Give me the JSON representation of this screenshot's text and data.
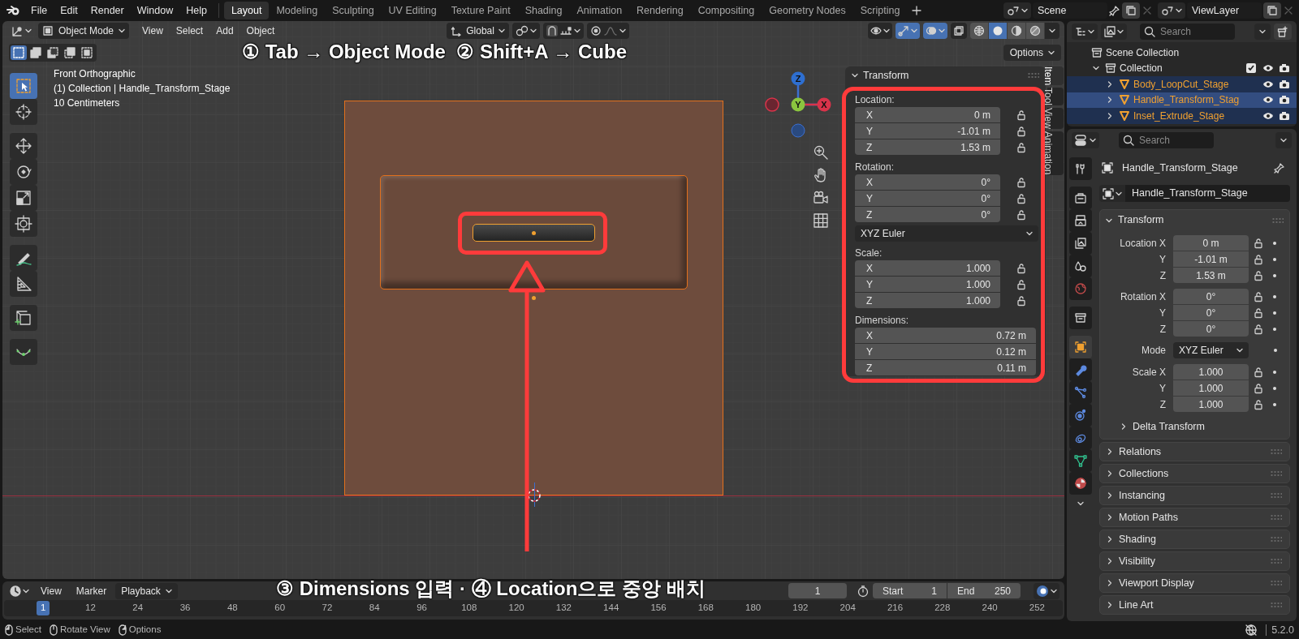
{
  "menu": [
    "File",
    "Edit",
    "Render",
    "Window",
    "Help"
  ],
  "workspaces": [
    {
      "label": "Layout",
      "selected": true
    },
    {
      "label": "Modeling",
      "selected": false
    },
    {
      "label": "Sculpting",
      "selected": false
    },
    {
      "label": "UV Editing",
      "selected": false
    },
    {
      "label": "Texture Paint",
      "selected": false
    },
    {
      "label": "Shading",
      "selected": false
    },
    {
      "label": "Animation",
      "selected": false
    },
    {
      "label": "Rendering",
      "selected": false
    },
    {
      "label": "Compositing",
      "selected": false
    },
    {
      "label": "Geometry Nodes",
      "selected": false
    },
    {
      "label": "Scripting",
      "selected": false
    }
  ],
  "scene": "Scene",
  "view_layer": "ViewLayer",
  "viewport": {
    "mode": "Object Mode",
    "menus": [
      "View",
      "Select",
      "Add",
      "Object"
    ],
    "orientation": "Global",
    "options": "Options",
    "toggles": [
      {
        "kind": "visibility",
        "on": false
      },
      {
        "kind": "gizmo",
        "on": true
      },
      {
        "kind": "overlay",
        "on": true
      },
      {
        "kind": "xray",
        "on": false
      }
    ],
    "shading_modes": [
      {
        "kind": "wireframe",
        "selected": false
      },
      {
        "kind": "solid",
        "selected": true
      },
      {
        "kind": "material",
        "selected": false
      },
      {
        "kind": "rendered",
        "selected": false
      }
    ],
    "select_modes": [
      {
        "kind": "set",
        "selected": true
      },
      {
        "kind": "extend",
        "selected": false
      },
      {
        "kind": "subtract",
        "selected": false
      },
      {
        "kind": "invert",
        "selected": false
      },
      {
        "kind": "intersect",
        "selected": false
      }
    ],
    "info": [
      "Front Orthographic",
      "(1) Collection | Handle_Transform_Stage",
      "10 Centimeters"
    ],
    "tools": [
      {
        "kind": "select_box",
        "selected": true
      },
      {
        "kind": "cursor",
        "selected": false
      },
      {
        "kind": "move",
        "selected": false
      },
      {
        "kind": "rotate",
        "selected": false
      },
      {
        "kind": "scale",
        "selected": false
      },
      {
        "kind": "transform",
        "selected": false
      },
      {
        "kind": "annotate",
        "selected": false
      },
      {
        "kind": "measure",
        "selected": false
      },
      {
        "kind": "add_cube",
        "selected": false
      },
      {
        "kind": "curve",
        "selected": false
      }
    ],
    "axes": {
      "up": "Z",
      "center": "Y",
      "right": "X"
    },
    "side_tabs": [
      {
        "label": "Item",
        "selected": true
      },
      {
        "label": "Tool",
        "selected": false
      },
      {
        "label": "View",
        "selected": false
      },
      {
        "label": "Animation",
        "selected": false
      }
    ],
    "captions": [
      "① Tab → Object Mode  ② Shift+A → Cube",
      "③ Dimensions 입력 · ④ Location으로 중앙 배치"
    ]
  },
  "n_panel": {
    "title": "Transform",
    "expanded": true,
    "sections": [
      {
        "kind": "fields",
        "label": "Location:",
        "rows": [
          {
            "axis": "X",
            "value": "0 m",
            "locked": false
          },
          {
            "axis": "Y",
            "value": "-1.01 m",
            "locked": false
          },
          {
            "axis": "Z",
            "value": "1.53 m",
            "locked": false
          }
        ]
      },
      {
        "kind": "fields",
        "label": "Rotation:",
        "rows": [
          {
            "axis": "X",
            "value": "0°",
            "locked": false
          },
          {
            "axis": "Y",
            "value": "0°",
            "locked": false
          },
          {
            "axis": "Z",
            "value": "0°",
            "locked": false
          }
        ]
      },
      {
        "kind": "dropdown",
        "value": "XYZ Euler"
      },
      {
        "kind": "fields",
        "label": "Scale:",
        "rows": [
          {
            "axis": "X",
            "value": "1.000",
            "locked": false
          },
          {
            "axis": "Y",
            "value": "1.000",
            "locked": false
          },
          {
            "axis": "Z",
            "value": "1.000",
            "locked": false
          }
        ]
      },
      {
        "kind": "fields",
        "label": "Dimensions:",
        "rows": [
          {
            "axis": "X",
            "value": "0.72 m"
          },
          {
            "axis": "Y",
            "value": "0.12 m"
          },
          {
            "axis": "Z",
            "value": "0.11 m"
          }
        ]
      }
    ]
  },
  "outliner": {
    "search_placeholder": "Search",
    "tree": [
      {
        "label": "Scene Collection",
        "children": [
          {
            "label": "Collection",
            "expanded": true,
            "checked": true,
            "children": [
              {
                "label": "Body_LoopCut_Stage",
                "expanded": false,
                "selected": true,
                "active": false
              },
              {
                "label": "Handle_Transform_Stag",
                "expanded": false,
                "selected": true,
                "active": true
              },
              {
                "label": "Inset_Extrude_Stage",
                "expanded": false,
                "selected": true,
                "active": false
              }
            ]
          }
        ]
      }
    ]
  },
  "properties": {
    "search_placeholder": "Search",
    "tabs": [
      {
        "kind": "tool",
        "selected": false
      },
      {
        "kind": "render",
        "selected": false
      },
      {
        "kind": "output",
        "selected": false
      },
      {
        "kind": "view_layer",
        "selected": false
      },
      {
        "kind": "scene",
        "selected": false
      },
      {
        "kind": "world",
        "selected": false
      },
      {
        "kind": "collection",
        "selected": false
      },
      {
        "kind": "object",
        "selected": true
      },
      {
        "kind": "modifiers",
        "selected": false
      },
      {
        "kind": "particles",
        "selected": false
      },
      {
        "kind": "physics",
        "selected": false
      },
      {
        "kind": "constraints",
        "selected": false
      },
      {
        "kind": "data",
        "selected": false
      },
      {
        "kind": "material",
        "selected": false
      }
    ],
    "object_name": "Handle_Transform_Stage",
    "datablock": "Handle_Transform_Stage",
    "transform": {
      "title": "Transform",
      "expanded": true,
      "groups": [
        [
          {
            "kind": "field",
            "label": "Location X",
            "value": "0 m",
            "locked": false
          },
          {
            "kind": "field",
            "label": "Y",
            "value": "-1.01 m",
            "locked": false
          },
          {
            "kind": "field",
            "label": "Z",
            "value": "1.53 m",
            "locked": false
          }
        ],
        [
          {
            "kind": "field",
            "label": "Rotation X",
            "value": "0°",
            "locked": false
          },
          {
            "kind": "field",
            "label": "Y",
            "value": "0°",
            "locked": false
          },
          {
            "kind": "field",
            "label": "Z",
            "value": "0°",
            "locked": false
          }
        ],
        [
          {
            "kind": "dropdown",
            "label": "Mode",
            "value": "XYZ Euler"
          }
        ],
        [
          {
            "kind": "field",
            "label": "Scale X",
            "value": "1.000",
            "locked": false
          },
          {
            "kind": "field",
            "label": "Y",
            "value": "1.000",
            "locked": false
          },
          {
            "kind": "field",
            "label": "Z",
            "value": "1.000",
            "locked": false
          }
        ]
      ],
      "delta": {
        "label": "Delta Transform",
        "expanded": false
      }
    },
    "panels": [
      {
        "label": "Relations",
        "expanded": false
      },
      {
        "label": "Collections",
        "expanded": false
      },
      {
        "label": "Instancing",
        "expanded": false
      },
      {
        "label": "Motion Paths",
        "expanded": false
      },
      {
        "label": "Shading",
        "expanded": false
      },
      {
        "label": "Visibility",
        "expanded": false
      },
      {
        "label": "Viewport Display",
        "expanded": false
      },
      {
        "label": "Line Art",
        "expanded": false
      }
    ]
  },
  "timeline": {
    "menus": [
      "View",
      "Marker"
    ],
    "playback": "Playback",
    "current_frame": "1",
    "start_label": "Start",
    "start": "1",
    "end_label": "End",
    "end": "250",
    "ticks": [
      {
        "label": "1",
        "selected": true
      },
      {
        "label": "12",
        "selected": false
      },
      {
        "label": "24",
        "selected": false
      },
      {
        "label": "36",
        "selected": false
      },
      {
        "label": "48",
        "selected": false
      },
      {
        "label": "60",
        "selected": false
      },
      {
        "label": "72",
        "selected": false
      },
      {
        "label": "84",
        "selected": false
      },
      {
        "label": "96",
        "selected": false
      },
      {
        "label": "108",
        "selected": false
      },
      {
        "label": "120",
        "selected": false
      },
      {
        "label": "132",
        "selected": false
      },
      {
        "label": "144",
        "selected": false
      },
      {
        "label": "156",
        "selected": false
      },
      {
        "label": "168",
        "selected": false
      },
      {
        "label": "180",
        "selected": false
      },
      {
        "label": "192",
        "selected": false
      },
      {
        "label": "204",
        "selected": false
      },
      {
        "label": "216",
        "selected": false
      },
      {
        "label": "228",
        "selected": false
      },
      {
        "label": "240",
        "selected": false
      },
      {
        "label": "252",
        "selected": false
      }
    ]
  },
  "status_bar": {
    "hints": [
      "Select",
      "Rotate View",
      "Options"
    ],
    "version": "5.2.0"
  }
}
